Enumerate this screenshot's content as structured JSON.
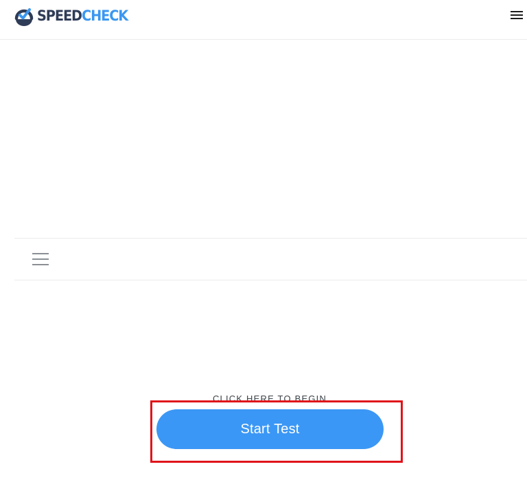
{
  "header": {
    "logo": {
      "text_primary": "SPEED",
      "text_accent": "CHECK",
      "primary_color": "#2f3c57",
      "accent_color": "#3b97f0"
    },
    "menu_icon": "hamburger-menu-icon"
  },
  "subnav": {
    "toggle_icon": "hamburger-menu-icon"
  },
  "start_section": {
    "hint": "CLICK HERE TO BEGIN",
    "button_label": "Start Test",
    "button_color": "#3b97f5",
    "highlight_color": "#e0131a"
  }
}
